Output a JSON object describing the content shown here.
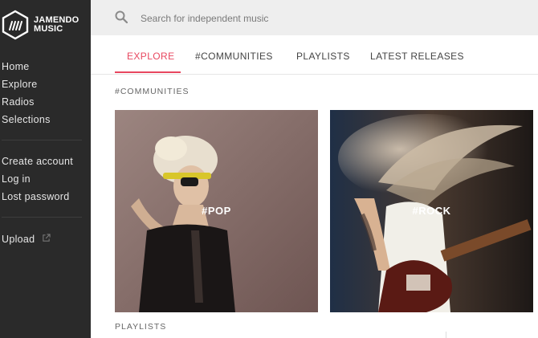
{
  "brand": {
    "line1": "JAMENDO",
    "line2": "MUSIC",
    "logo_icon": "jamendo-hexagon-logo",
    "background": "#2a2a2a"
  },
  "sidebar": {
    "main_items": [
      {
        "label": "Home"
      },
      {
        "label": "Explore"
      },
      {
        "label": "Radios"
      },
      {
        "label": "Selections"
      }
    ],
    "account_items": [
      {
        "label": "Create account"
      },
      {
        "label": "Log in"
      },
      {
        "label": "Lost password"
      }
    ],
    "upload": {
      "label": "Upload",
      "icon": "external-link-icon"
    }
  },
  "search": {
    "placeholder": "Search for independent music",
    "icon": "search-icon"
  },
  "tabs": [
    {
      "label": "EXPLORE",
      "active": true
    },
    {
      "label": "#COMMUNITIES",
      "active": false
    },
    {
      "label": "PLAYLISTS",
      "active": false
    },
    {
      "label": "LATEST RELEASES",
      "active": false
    }
  ],
  "accent_color": "#e8475f",
  "main": {
    "communities_heading": "#COMMUNITIES",
    "cards": [
      {
        "label": "#POP"
      },
      {
        "label": "#ROCK"
      }
    ],
    "playlists_heading": "PLAYLISTS"
  }
}
